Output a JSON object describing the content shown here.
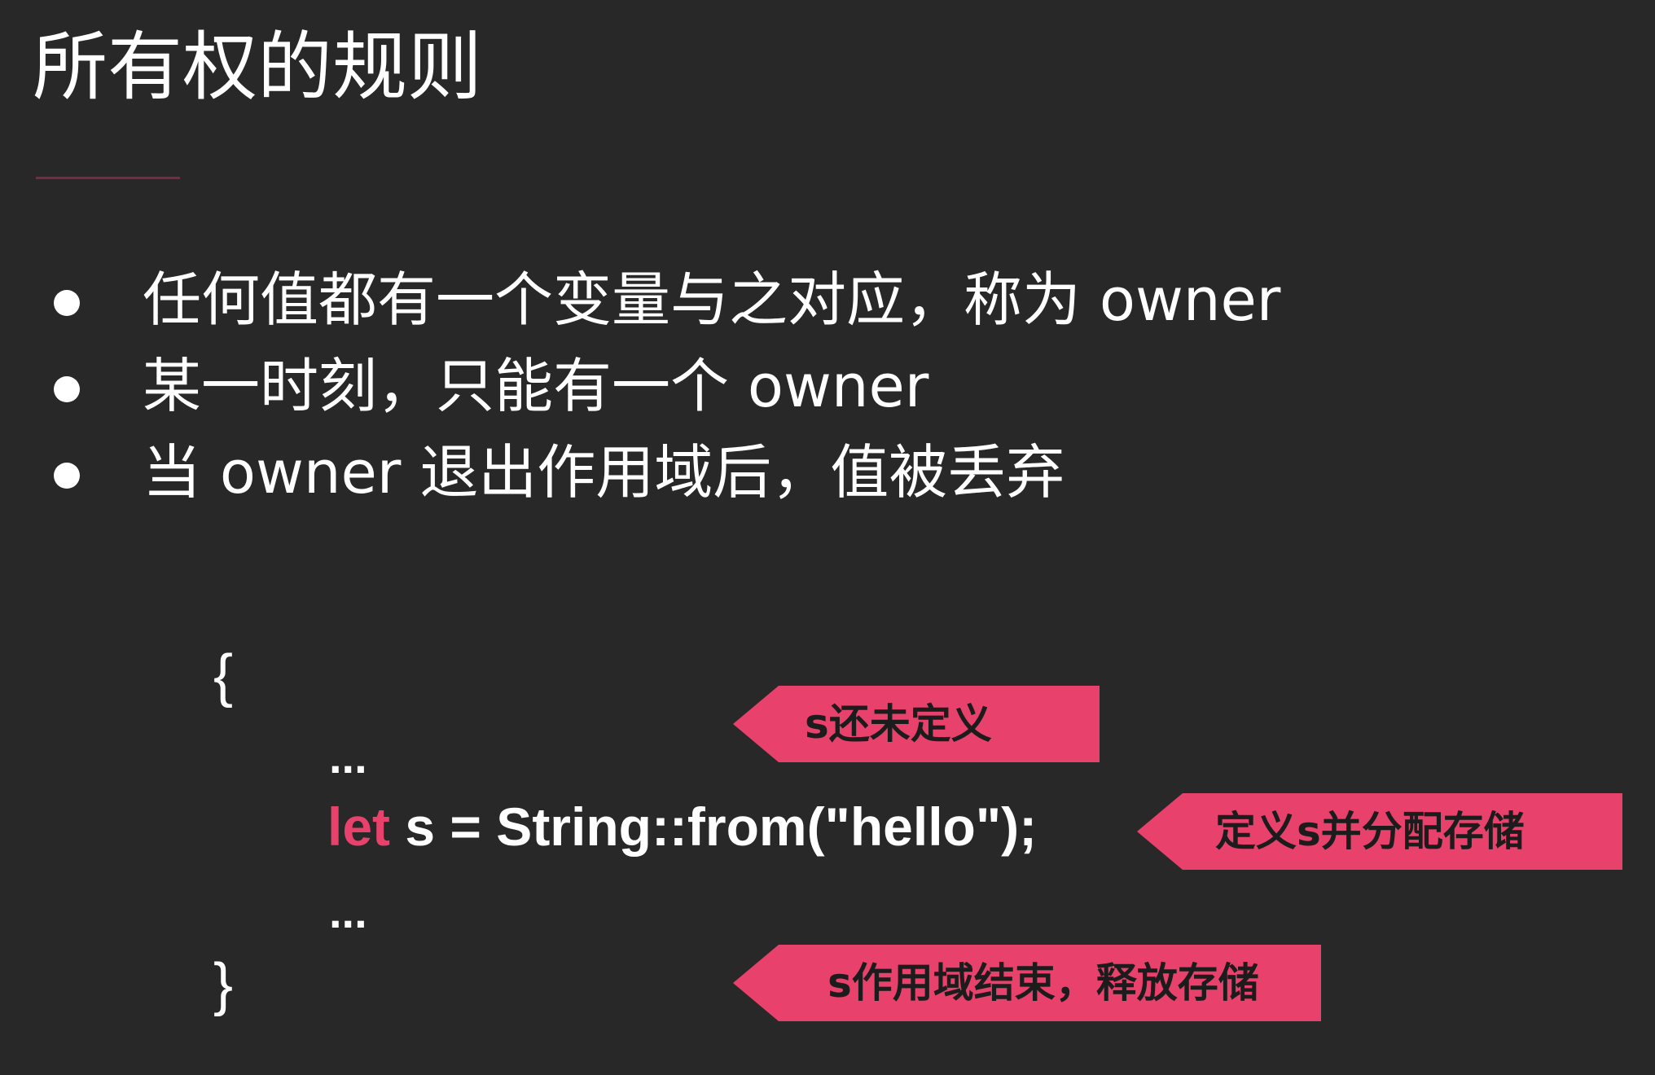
{
  "slide": {
    "title": "所有权的规则",
    "bullets": [
      "任何值都有一个变量与之对应，称为 owner",
      "某一时刻，只能有一个 owner",
      "当 owner 退出作用域后，值被丢弃"
    ],
    "code": {
      "open_brace": "{",
      "dots_before": "...",
      "keyword": "let",
      "statement": " s = String::from(\"hello\");",
      "dots_after": "...",
      "close_brace": "}"
    },
    "callouts": [
      "s还未定义",
      "定义s并分配存储",
      "s作用域结束，释放存储"
    ]
  },
  "colors": {
    "background": "#282829",
    "accent": "#e8416c",
    "text": "#ffffff",
    "callout_text": "#1c1c1c"
  }
}
